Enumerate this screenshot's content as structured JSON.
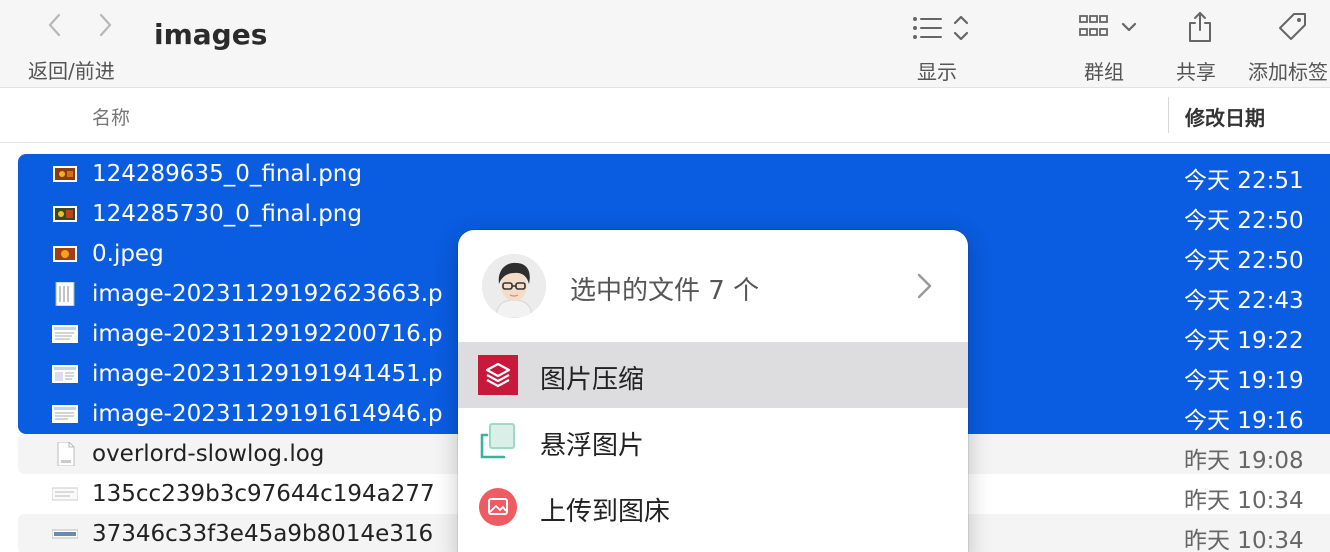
{
  "toolbar": {
    "nav_label": "返回/前进",
    "title": "images",
    "display_label": "显示",
    "group_label": "群组",
    "share_label": "共享",
    "tag_label": "添加标签"
  },
  "columns": {
    "name": "名称",
    "date": "修改日期"
  },
  "files": [
    {
      "name": "124289635_0_final.png",
      "date": "今天 22:51",
      "selected": true,
      "icon": "photo-thumb-icon"
    },
    {
      "name": "124285730_0_final.png",
      "date": "今天 22:50",
      "selected": true,
      "icon": "photo-thumb-icon"
    },
    {
      "name": "0.jpeg",
      "date": "今天 22:50",
      "selected": true,
      "icon": "photo-thumb-icon"
    },
    {
      "name": "image-20231129192623663.p",
      "date": "今天 22:43",
      "selected": true,
      "icon": "document-thumb-icon"
    },
    {
      "name": "image-20231129192200716.p",
      "date": "今天 19:22",
      "selected": true,
      "icon": "screenshot-thumb-icon"
    },
    {
      "name": "image-20231129191941451.p",
      "date": "今天 19:19",
      "selected": true,
      "icon": "screenshot-thumb-icon"
    },
    {
      "name": "image-20231129191614946.p",
      "date": "今天 19:16",
      "selected": true,
      "icon": "screenshot-thumb-icon"
    },
    {
      "name": "overlord-slowlog.log",
      "date": "昨天 19:08",
      "selected": false,
      "icon": "log-file-icon"
    },
    {
      "name": "135cc239b3c97644c194a277",
      "date": "昨天 10:34",
      "selected": false,
      "icon": "screenshot-thumb-icon"
    },
    {
      "name": "37346c33f3e45a9b8014e316",
      "date": "昨天 10:34",
      "selected": false,
      "icon": "screenshot-thumb-icon"
    }
  ],
  "popup": {
    "title": "选中的文件 7 个",
    "items": [
      {
        "label": "图片压缩",
        "icon": "layers-compress-icon",
        "highlighted": true
      },
      {
        "label": "悬浮图片",
        "icon": "float-image-icon",
        "highlighted": false
      },
      {
        "label": "上传到图床",
        "icon": "upload-image-icon",
        "highlighted": false
      }
    ]
  },
  "colors": {
    "selection": "#0a5ce0",
    "compress_icon": "#c8183c",
    "float_icon": "#3bb39a",
    "upload_icon": "#ee5b62"
  }
}
